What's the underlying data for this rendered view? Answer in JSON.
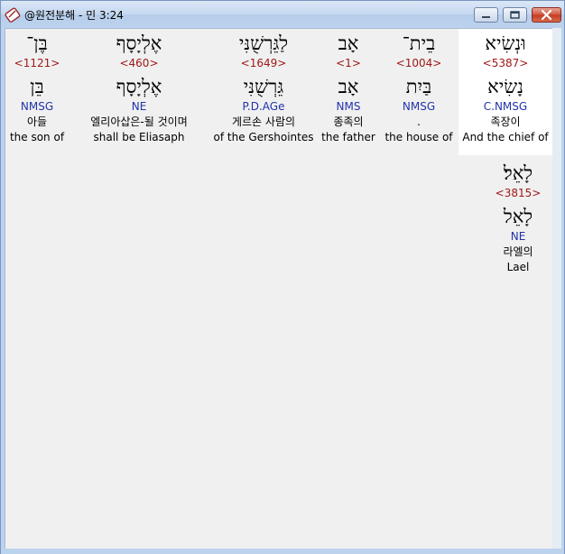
{
  "window": {
    "title": "@원전분해 - 민 3:24"
  },
  "words": [
    {
      "hebrew": "וּנְשִׂיא",
      "strong": "<5387>",
      "lemma": "נָשִׂיא",
      "morph": "C.NMSG",
      "korean": "족장이",
      "english": "And the chief of",
      "highlighted": true
    },
    {
      "hebrew": "בֵית־",
      "strong": "<1004>",
      "lemma": "בַּיִת",
      "morph": "NMSG",
      "korean": ".",
      "english": "the house of",
      "highlighted": false
    },
    {
      "hebrew": "אָב",
      "strong": "<1>",
      "lemma": "אָב",
      "morph": "NMS",
      "korean": "종족의",
      "english": "the father",
      "highlighted": false
    },
    {
      "hebrew": "לַגֵּרְשֻׁנִּי",
      "strong": "<1649>",
      "lemma": "גֵּרְשֻׁנִּי",
      "morph": "P.D.AGe",
      "korean": "게르손 사람의",
      "english": "of the Gershointes",
      "highlighted": false
    },
    {
      "hebrew": "אֶלְיָסָף",
      "strong": "<460>",
      "lemma": "אֶלְיָסָף",
      "morph": "NE",
      "korean": "엘리아삽은-될 것이며",
      "english": "shall be Eliasaph",
      "highlighted": false
    },
    {
      "hebrew": "בֶּן־",
      "strong": "<1121>",
      "lemma": "בֵּן",
      "morph": "NMSG",
      "korean": "아들",
      "english": "the son of",
      "highlighted": false
    },
    {
      "hebrew": "לָאֵל׃",
      "strong": "<3815>",
      "lemma": "לָאֵל",
      "morph": "NE",
      "korean": "라엘의",
      "english": "Lael",
      "highlighted": false
    }
  ],
  "colors": {
    "strong": "#a01818",
    "morph": "#2233aa",
    "text": "#000000",
    "highlight": "#ffffff",
    "client_bg": "#f0f0f0"
  },
  "icons": {
    "app": "app-icon",
    "minimize": "minimize-icon",
    "maximize": "maximize-icon",
    "close": "close-icon"
  }
}
